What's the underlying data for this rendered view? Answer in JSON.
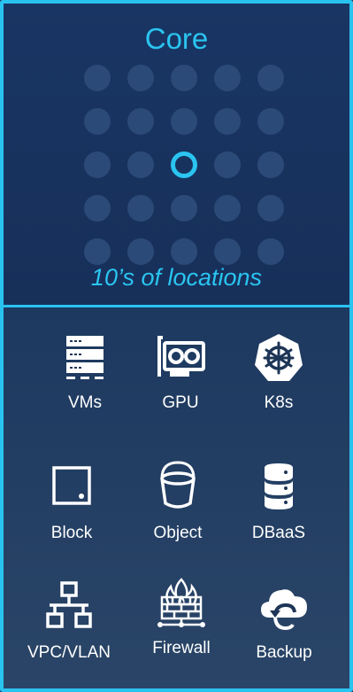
{
  "core": {
    "title": "Core",
    "subtitle": "10’s of locations",
    "grid": {
      "rows": 5,
      "cols": 5,
      "active_row": 2,
      "active_col": 2
    }
  },
  "colors": {
    "accent": "#2ac4f0",
    "dot": "#2c4a78",
    "text": "#ffffff"
  },
  "services": [
    {
      "label": "VMs",
      "icon": "server-stack-icon"
    },
    {
      "label": "GPU",
      "icon": "gpu-card-icon"
    },
    {
      "label": "K8s",
      "icon": "kubernetes-icon"
    },
    {
      "label": "Block",
      "icon": "block-storage-icon"
    },
    {
      "label": "Object",
      "icon": "bucket-icon"
    },
    {
      "label": "DBaaS",
      "icon": "database-icon"
    },
    {
      "label": "VPC/VLAN",
      "icon": "network-icon"
    },
    {
      "label": "Firewall",
      "icon": "firewall-icon"
    },
    {
      "label": "Backup",
      "icon": "cloud-backup-icon"
    }
  ]
}
